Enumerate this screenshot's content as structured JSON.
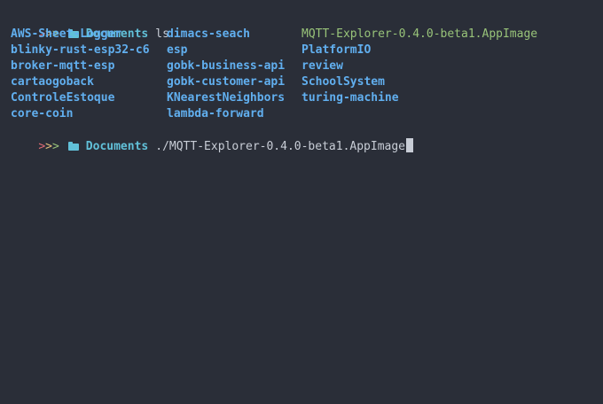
{
  "terminal": {
    "prompt1": {
      "arrows": [
        ">",
        ">",
        ">"
      ],
      "cwd": "Documents",
      "command": "ls"
    },
    "listing": [
      [
        {
          "name": "AWS-Sheet-Logger",
          "kind": "dir"
        },
        {
          "name": "dimacs-seach",
          "kind": "dir"
        },
        {
          "name": "MQTT-Explorer-0.4.0-beta1.AppImage",
          "kind": "exec"
        }
      ],
      [
        {
          "name": "blinky-rust-esp32-c6",
          "kind": "dir"
        },
        {
          "name": "esp",
          "kind": "dir"
        },
        {
          "name": "PlatformIO",
          "kind": "dir"
        }
      ],
      [
        {
          "name": "broker-mqtt-esp",
          "kind": "dir"
        },
        {
          "name": "gobk-business-api",
          "kind": "dir"
        },
        {
          "name": "review",
          "kind": "dir"
        }
      ],
      [
        {
          "name": "cartaogoback",
          "kind": "dir"
        },
        {
          "name": "gobk-customer-api",
          "kind": "dir"
        },
        {
          "name": "SchoolSystem",
          "kind": "dir"
        }
      ],
      [
        {
          "name": "ControleEstoque",
          "kind": "dir"
        },
        {
          "name": "KNearestNeighbors",
          "kind": "dir"
        },
        {
          "name": "turing-machine",
          "kind": "dir"
        }
      ],
      [
        {
          "name": "core-coin",
          "kind": "dir"
        },
        {
          "name": "lambda-forward",
          "kind": "dir"
        },
        null
      ]
    ],
    "prompt2": {
      "arrows": [
        ">",
        ">",
        ">"
      ],
      "cwd": "Documents",
      "command": "./MQTT-Explorer-0.4.0-beta1.AppImage"
    },
    "colors": {
      "background": "#2a2e38",
      "directory": "#61afef",
      "executable": "#98c379",
      "cwd": "#61c0d8",
      "arrow1": "#e06c75",
      "arrow2": "#e5c07b",
      "arrow3": "#98c379"
    }
  }
}
